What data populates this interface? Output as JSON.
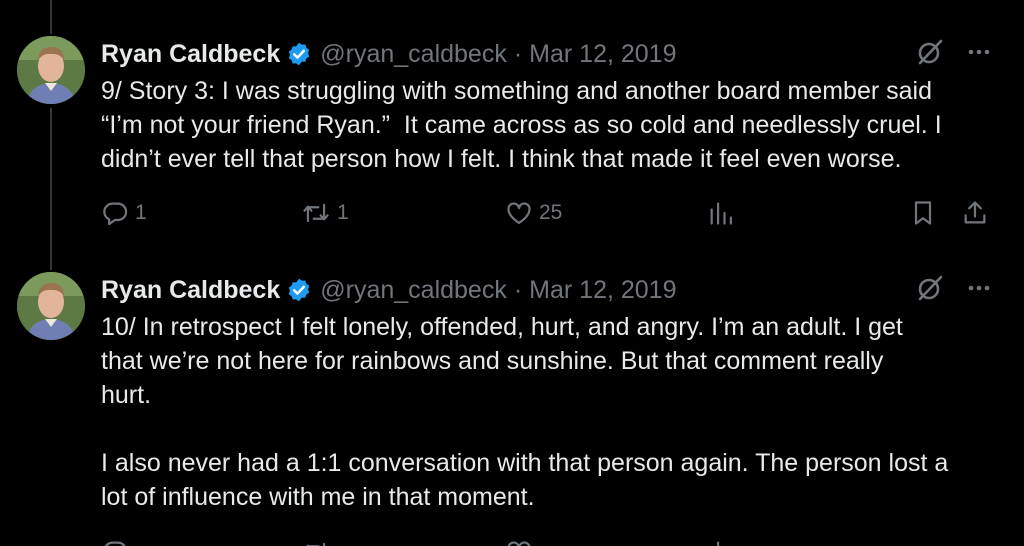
{
  "tweets": [
    {
      "author": {
        "name": "Ryan Caldbeck",
        "handle": "@ryan_caldbeck",
        "verified": true
      },
      "separator": "·",
      "date": "Mar 12, 2019",
      "text": "9/ Story 3: I was struggling with something and another board member said\n“I’m not your friend Ryan.”  It came across as so cold and needlessly cruel. I\ndidn’t ever tell that person how I felt. I think that made it feel even worse.",
      "stats": {
        "replies": "1",
        "reposts": "1",
        "likes": "25"
      }
    },
    {
      "author": {
        "name": "Ryan Caldbeck",
        "handle": "@ryan_caldbeck",
        "verified": true
      },
      "separator": "·",
      "date": "Mar 12, 2019",
      "text": "10/ In retrospect I felt lonely, offended, hurt, and angry. I’m an adult. I get\nthat we’re not here for rainbows and sunshine. But that comment really\nhurt.\n\nI also never had a 1:1 conversation with that person again. The person lost a\nlot of influence with me in that moment."
    }
  ],
  "colors": {
    "background": "#000000",
    "text": "#e7e9ea",
    "muted": "#71767b",
    "verified": "#1d9bf0",
    "thread_line": "#333639"
  },
  "icons": [
    "verified-badge-icon",
    "grok-icon",
    "more-icon",
    "reply-icon",
    "repost-icon",
    "like-icon",
    "views-icon",
    "bookmark-icon",
    "share-icon"
  ]
}
